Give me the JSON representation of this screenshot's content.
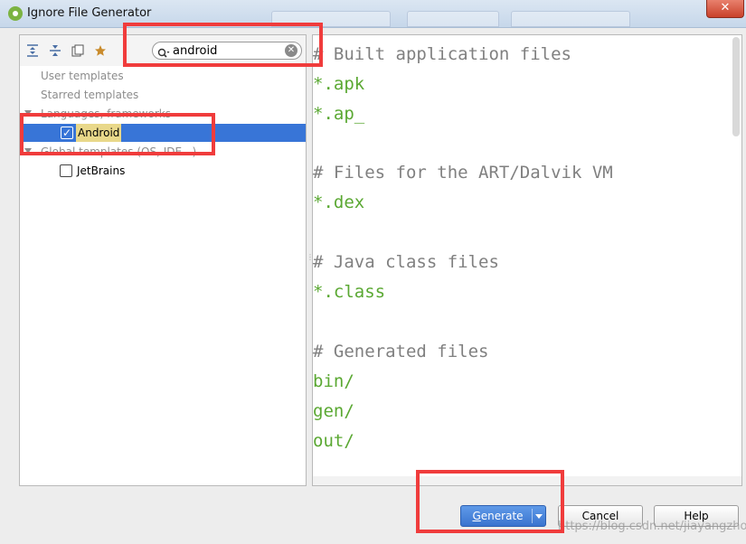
{
  "window": {
    "title": "Ignore File Generator",
    "close_label": "✕"
  },
  "toolbar": {
    "icons": [
      "expand-all-icon",
      "collapse-all-icon",
      "copy-icon",
      "star-icon"
    ]
  },
  "search": {
    "value": "android",
    "placeholder": ""
  },
  "tree": {
    "user_templates": "User templates",
    "starred_templates": "Starred templates",
    "languages_group": "Languages, frameworks",
    "android": "Android",
    "global_group": "Global templates (OS, IDE...)",
    "jetbrains": "JetBrains"
  },
  "editor": {
    "lines": [
      "# Built application files",
      "*.apk",
      "*.ap_",
      "",
      "# Files for the ART/Dalvik VM",
      "*.dex",
      "",
      "# Java class files",
      "*.class",
      "",
      "# Generated files",
      "bin/",
      "gen/",
      "out/"
    ]
  },
  "buttons": {
    "generate": "Generate",
    "cancel": "Cancel",
    "help": "Help"
  },
  "watermark": "https://blog.csdn.net/jiayangzhou",
  "colors": {
    "selection": "#3875d7",
    "highlight": "#f03c3c",
    "comment": "#808080",
    "pattern": "#5aa832"
  }
}
